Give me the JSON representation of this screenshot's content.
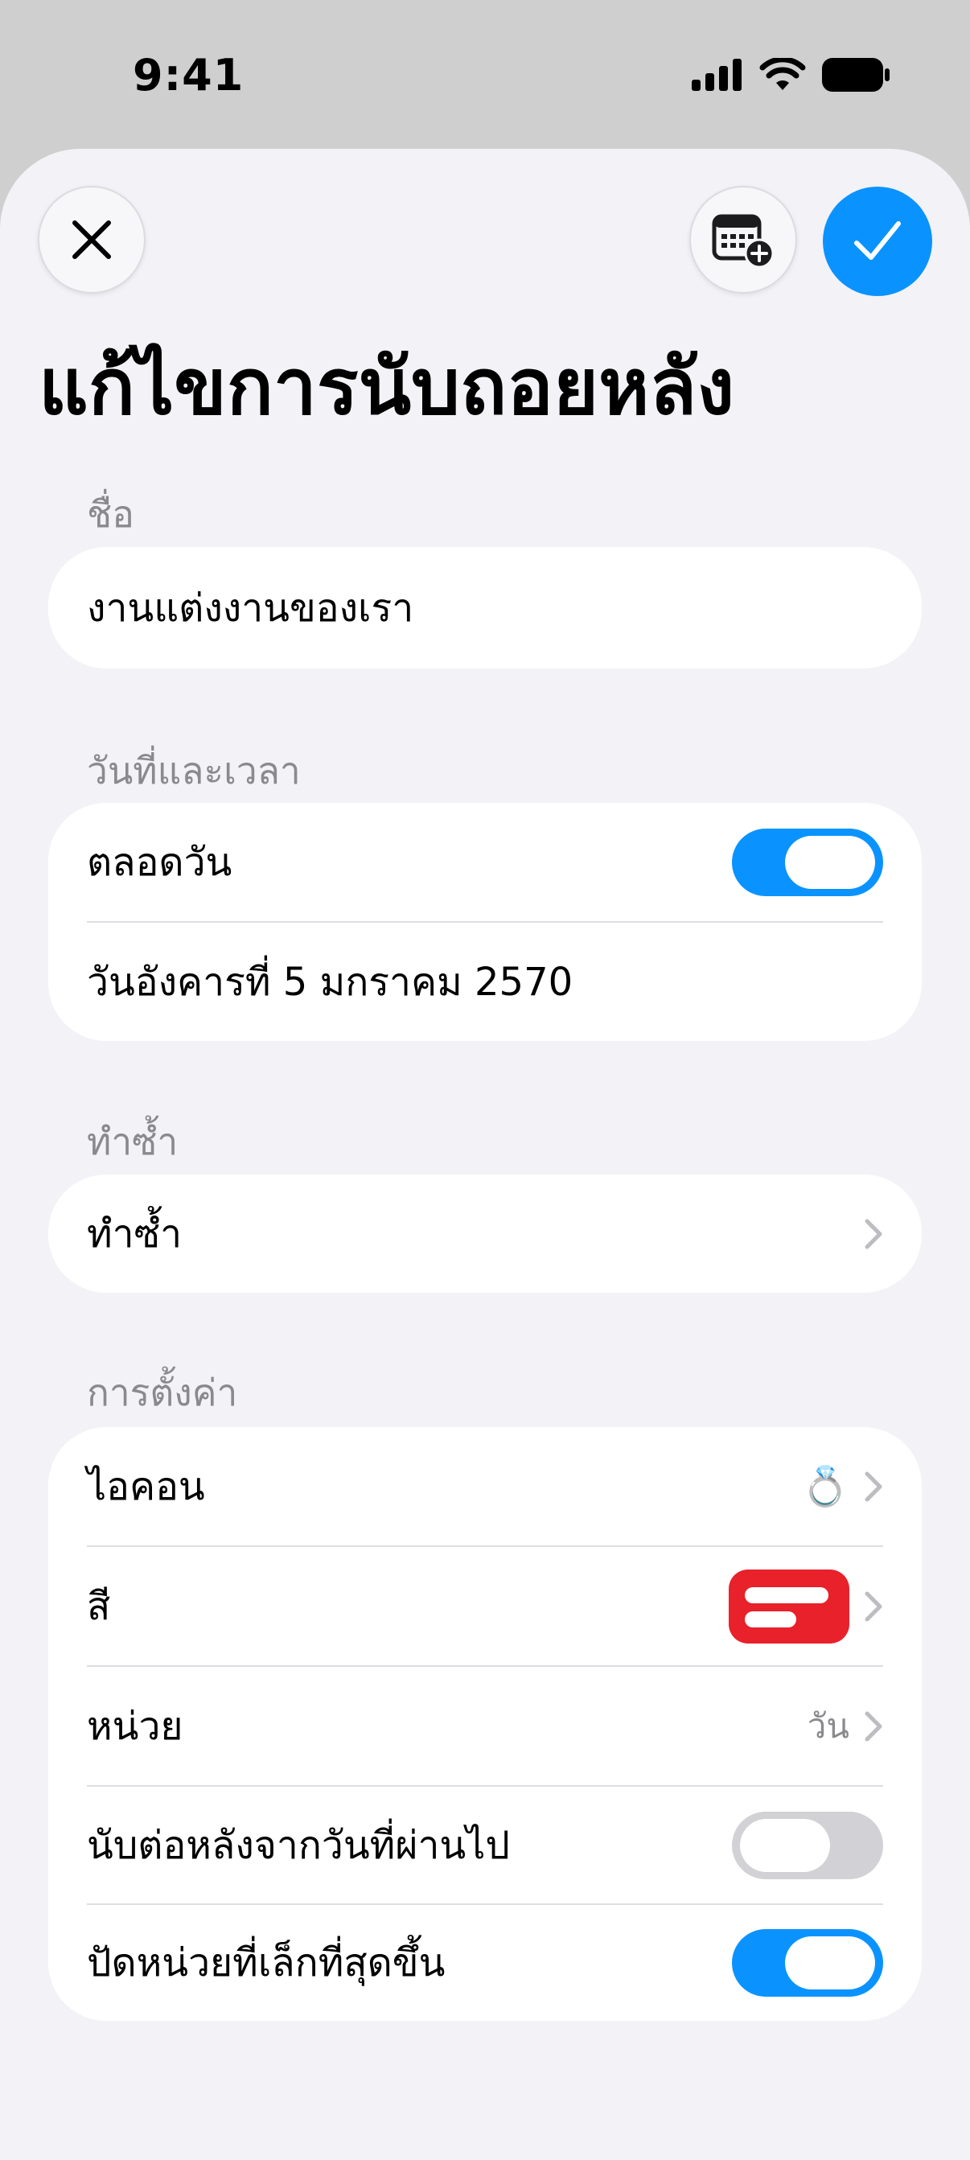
{
  "status": {
    "time": "9:41"
  },
  "header": {
    "title": "แก้ไขการนับถอยหลัง"
  },
  "name_section": {
    "label": "ชื่อ",
    "value": "งานแต่งงานของเรา"
  },
  "datetime_section": {
    "label": "วันที่และเวลา",
    "all_day_label": "ตลอดวัน",
    "all_day_on": true,
    "date_value": "วันอังคารที่ 5 มกราคม 2570"
  },
  "repeat_section": {
    "label": "ทำซ้ำ",
    "row_label": "ทำซ้ำ"
  },
  "settings_section": {
    "label": "การตั้งค่า",
    "icon_label": "ไอคอน",
    "icon_value": "💍",
    "color_label": "สี",
    "color_value": "#e8212b",
    "unit_label": "หน่วย",
    "unit_value": "วัน",
    "count_up_label": "นับต่อหลังจากวันที่ผ่านไป",
    "count_up_on": false,
    "round_up_label": "ปัดหน่วยที่เล็กที่สุดขึ้น",
    "round_up_on": true
  },
  "colors": {
    "accent": "#0a93ff",
    "background": "#f2f2f7"
  }
}
